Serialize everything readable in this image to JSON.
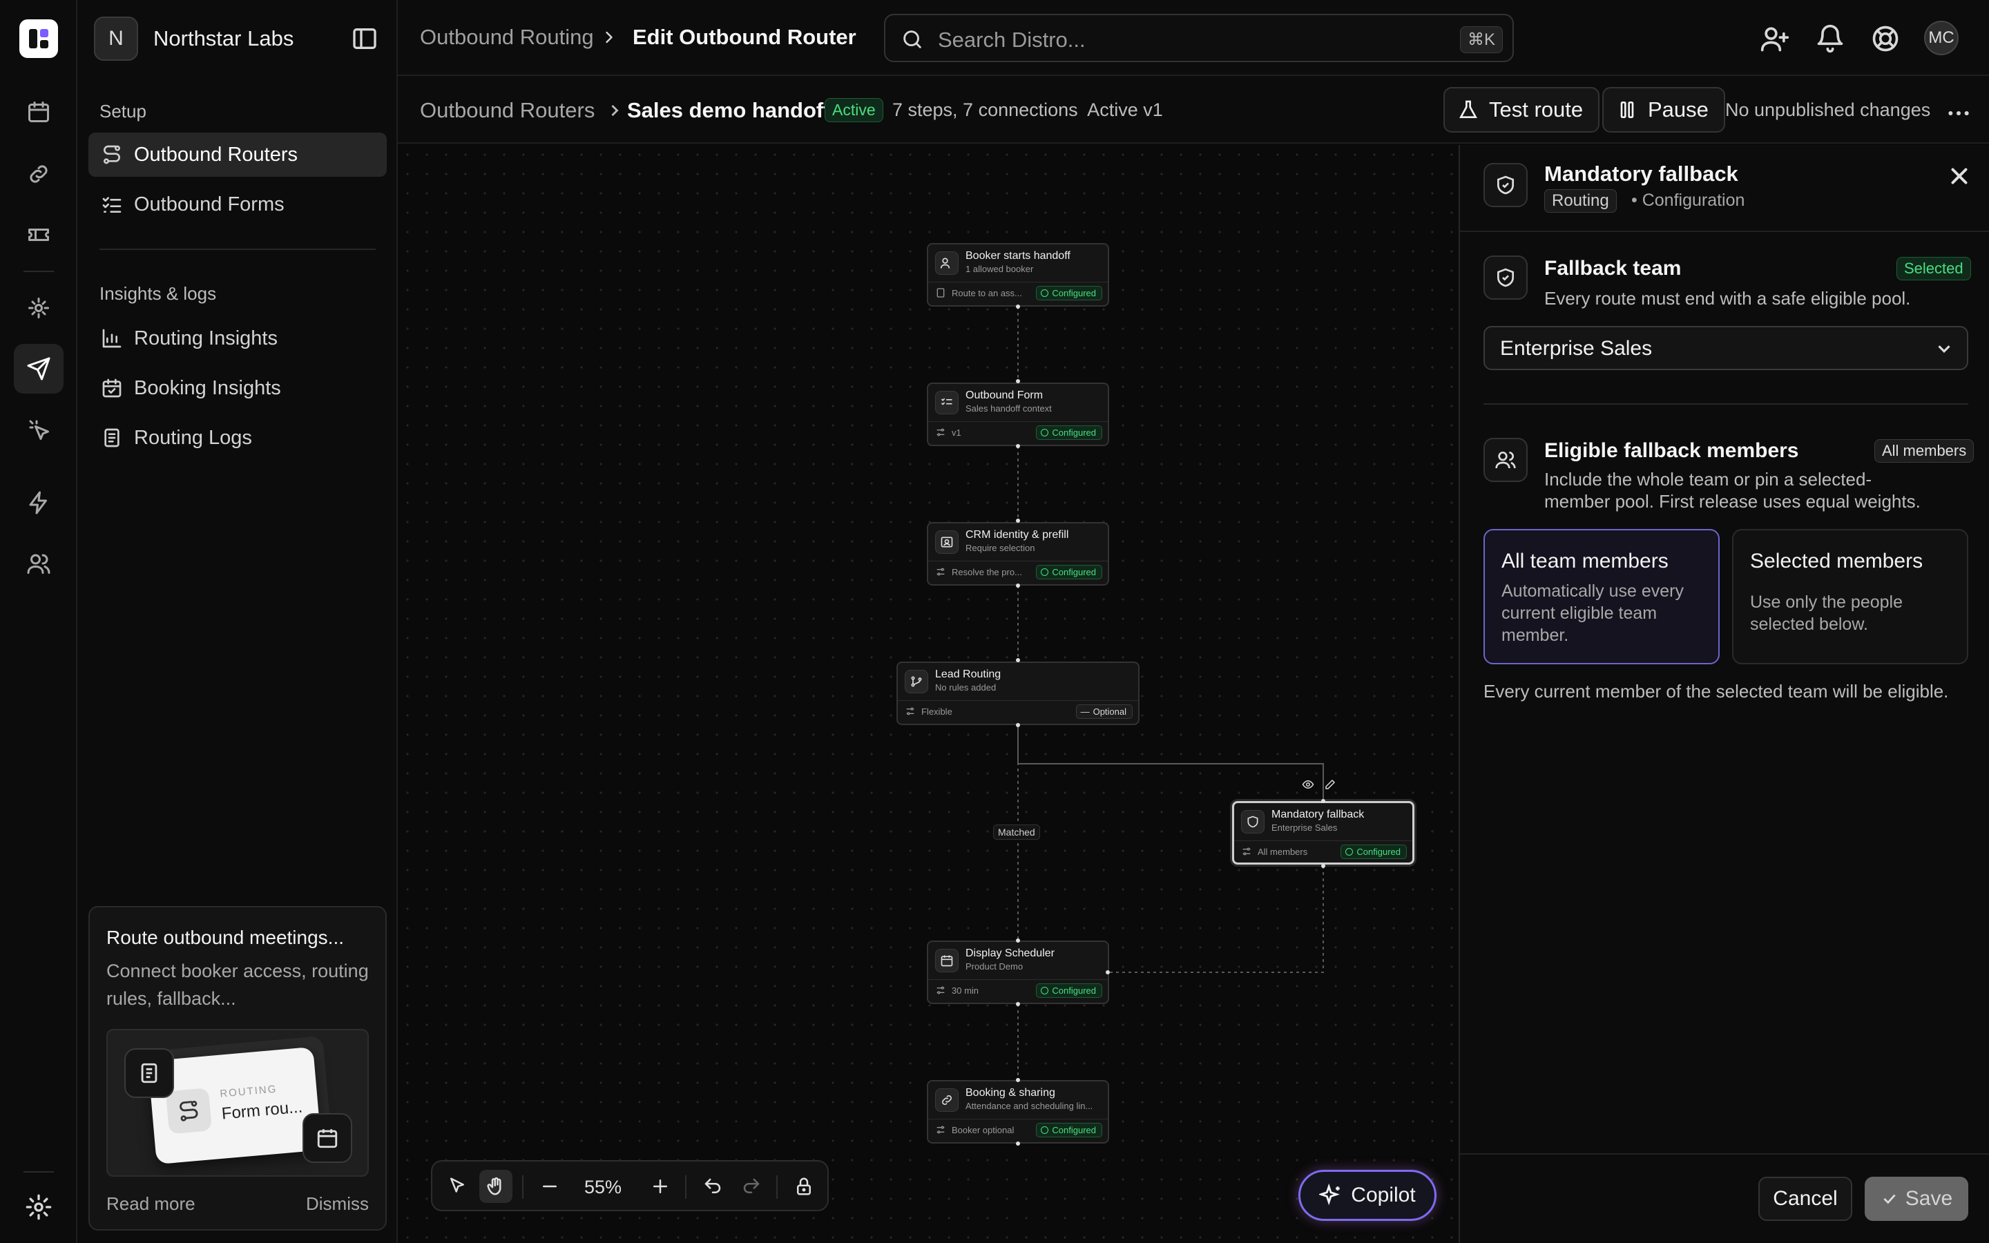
{
  "org": {
    "initial": "N",
    "name": "Northstar Labs"
  },
  "sidebar": {
    "setup_label": "Setup",
    "setup_items": [
      {
        "label": "Outbound Routers",
        "icon": "route-icon",
        "active": true
      },
      {
        "label": "Outbound Forms",
        "icon": "list-checks-icon",
        "active": false
      }
    ],
    "insights_label": "Insights & logs",
    "insight_items": [
      {
        "label": "Routing Insights",
        "icon": "bar-chart-icon"
      },
      {
        "label": "Booking Insights",
        "icon": "calendar-check-icon"
      },
      {
        "label": "Routing Logs",
        "icon": "document-icon"
      }
    ],
    "promo": {
      "title": "Route outbound meetings...",
      "body": "Connect booker access, routing rules, fallback...",
      "card_kicker": "ROUTING",
      "card_title": "Form rou...",
      "read_more": "Read more",
      "dismiss": "Dismiss"
    }
  },
  "rail_icons": [
    "calendar-icon",
    "link-icon",
    "ticket-icon",
    "routing-icon",
    "send-icon",
    "cursor-click-icon",
    "zap-icon",
    "users-icon",
    "settings-icon"
  ],
  "topbar": {
    "breadcrumb_parent": "Outbound Routing",
    "breadcrumb_current": "Edit Outbound Router",
    "search_placeholder": "Search Distro...",
    "search_shortcut": "⌘K",
    "user_initials": "MC"
  },
  "subbar": {
    "breadcrumb_parent": "Outbound Routers",
    "title": "Sales demo handoff",
    "status_badge": "Active",
    "meta": "7 steps, 7 connections  Active v1",
    "test_label": "Test route",
    "pause_label": "Pause",
    "publish_status": "No unpublished changes"
  },
  "canvas": {
    "nodes": [
      {
        "title": "Booker starts handoff",
        "sub": "1 allowed booker",
        "foot": "Route to an ass...",
        "badge": "Configured"
      },
      {
        "title": "Outbound Form",
        "sub": "Sales handoff context",
        "foot": "v1",
        "badge": "Configured"
      },
      {
        "title": "CRM identity & prefill",
        "sub": "Require selection",
        "foot": "Resolve the pro...",
        "badge": "Configured"
      },
      {
        "title": "Lead Routing",
        "sub": "No rules added",
        "foot": "Flexible",
        "badge": "Optional"
      },
      {
        "title": "Mandatory fallback",
        "sub": "Enterprise Sales",
        "foot": "All members",
        "badge": "Configured"
      },
      {
        "title": "Display Scheduler",
        "sub": "Product Demo",
        "foot": "30 min",
        "badge": "Configured"
      },
      {
        "title": "Booking & sharing",
        "sub": "Attendance and scheduling lin...",
        "foot": "Booker optional",
        "badge": "Configured"
      }
    ],
    "edge_label": "Matched",
    "zoom": "55%",
    "copilot_label": "Copilot"
  },
  "panel": {
    "title": "Mandatory fallback",
    "tag": "Routing",
    "subtitle": "Configuration",
    "fallback_team": {
      "title": "Fallback team",
      "pill": "Selected",
      "desc": "Every route must end with a safe eligible pool.",
      "selected_value": "Enterprise Sales"
    },
    "members": {
      "title": "Eligible fallback members",
      "pill": "All members",
      "desc": "Include the whole team or pin a selected-member pool. First release uses equal weights.",
      "option_all_title": "All team members",
      "option_all_desc": "Automatically use every current eligible team member.",
      "option_selected_title": "Selected members",
      "option_selected_desc": "Use only the people selected below.",
      "note": "Every current member of the selected team will be eligible."
    },
    "cancel_label": "Cancel",
    "save_label": "Save"
  },
  "colors": {
    "success": "#4ade80",
    "accent": "#6d65c9",
    "background": "#0a0a0a"
  }
}
